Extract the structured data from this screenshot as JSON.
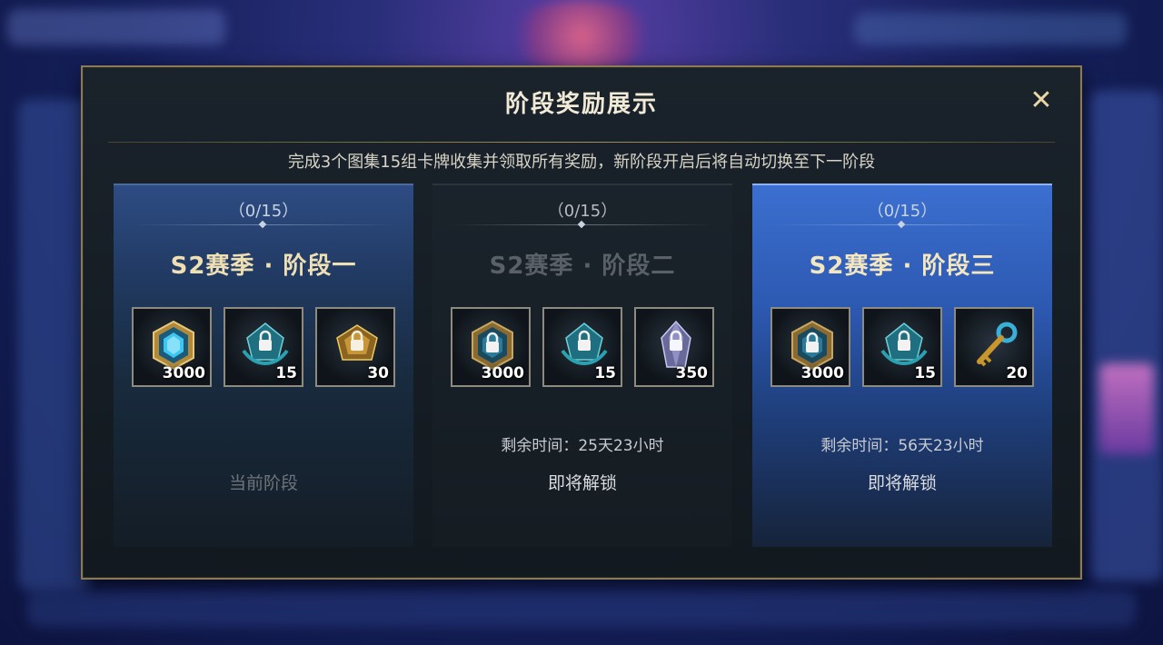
{
  "modal": {
    "title": "阶段奖励展示",
    "close_symbol": "✕",
    "subtitle": "完成3个图集15组卡牌收集并领取所有奖励，新阶段开启后将自动切换至下一阶段"
  },
  "stages": [
    {
      "progress": "（0/15）",
      "name": "S2赛季 · 阶段一",
      "rewards": [
        {
          "icon": "blue-crystal-emblem-icon",
          "count": "3000"
        },
        {
          "icon": "locked-teal-chest-icon",
          "count": "15"
        },
        {
          "icon": "locked-gold-chest-icon",
          "count": "30"
        }
      ],
      "time_left": "",
      "status": "当前阶段"
    },
    {
      "progress": "（0/15）",
      "name": "S2赛季 · 阶段二",
      "rewards": [
        {
          "icon": "locked-emblem-icon",
          "count": "3000"
        },
        {
          "icon": "locked-teal-chest-icon",
          "count": "15"
        },
        {
          "icon": "locked-crystal-icon",
          "count": "350"
        }
      ],
      "time_left": "剩余时间：25天23小时",
      "status": "即将解锁"
    },
    {
      "progress": "（0/15）",
      "name": "S2赛季 · 阶段三",
      "rewards": [
        {
          "icon": "locked-emblem-icon",
          "count": "3000"
        },
        {
          "icon": "locked-teal-chest-icon",
          "count": "15"
        },
        {
          "icon": "gold-key-icon",
          "count": "20"
        }
      ],
      "time_left": "剩余时间：56天23小时",
      "status": "即将解锁"
    }
  ],
  "colors": {
    "accent_gold": "#e8d7a4",
    "card_active_blue": "#3b6fd0",
    "border": "#8a7a55"
  }
}
